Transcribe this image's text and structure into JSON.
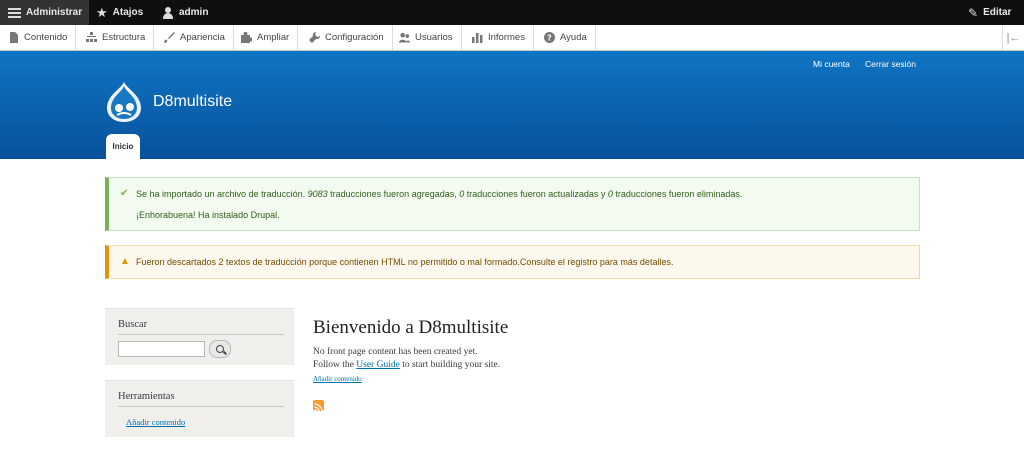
{
  "toolbar": {
    "admin_label": "Administrar",
    "shortcuts_label": "Atajos",
    "user_label": "admin",
    "edit_label": "Editar"
  },
  "tray": {
    "items": [
      {
        "label": "Contenido",
        "icon": "file-icon"
      },
      {
        "label": "Estructura",
        "icon": "structure-icon"
      },
      {
        "label": "Apariencia",
        "icon": "paintbrush-icon"
      },
      {
        "label": "Ampliar",
        "icon": "puzzle-icon"
      },
      {
        "label": "Configuración",
        "icon": "wrench-icon"
      },
      {
        "label": "Usuarios",
        "icon": "people-icon"
      },
      {
        "label": "Informes",
        "icon": "bar-chart-icon"
      },
      {
        "label": "Ayuda",
        "icon": "help-icon"
      }
    ]
  },
  "header": {
    "secondary_menu": [
      "Mi cuenta",
      "Cerrar sesión"
    ],
    "site_name": "D8multisite",
    "tab_home": "Inicio"
  },
  "messages": {
    "status_line1_a": "Se ha importado un archivo de traducción. ",
    "status_count_added": "9083",
    "status_line1_b": " traducciones fueron agregadas, ",
    "status_count_updated": "0",
    "status_line1_c": " traducciones fueron actualizadas y ",
    "status_count_deleted": "0",
    "status_line1_d": " traducciones fueron eliminadas.",
    "status_line2": "¡Enhorabuena! Ha instalado Drupal.",
    "warning": "Fueron descartados 2 textos de traducción porque contienen HTML no permitido o mal formado.Consulte el registro para más detalles."
  },
  "sidebar": {
    "search_title": "Buscar",
    "search_value": "",
    "tools_title": "Herramientas",
    "tools_link": "Añadir contenido"
  },
  "main": {
    "title": "Bienvenido a D8multisite",
    "line1": "No front page content has been created yet.",
    "line2_a": "Follow the ",
    "line2_link": "User Guide",
    "line2_b": " to start building your site.",
    "add_content_link": "Añadir contenido"
  },
  "colors": {
    "header_blue": "#0a5ca8",
    "status_green": "#77b259",
    "warning_orange": "#e09600",
    "link_blue": "#0071b3"
  }
}
